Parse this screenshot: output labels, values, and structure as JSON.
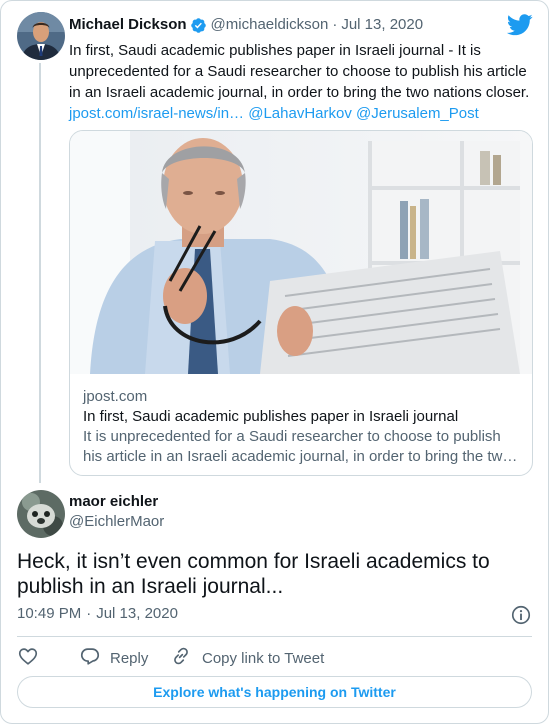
{
  "parent_tweet": {
    "author_name": "Michael Dickson",
    "handle": "@michaeldickson",
    "separator": "·",
    "date": "Jul 13, 2020",
    "text": "In first, Saudi academic publishes paper in Israeli journal  - It is unprecedented for a Saudi researcher to choose to publish his article in an Israeli academic journal, in order to bring the two nations closer.",
    "link_url": "jpost.com/israel-news/in…",
    "mention_1": "@LahavHarkov",
    "mention_2": "@Jerusalem_Post"
  },
  "link_card": {
    "domain": "jpost.com",
    "title": "In first, Saudi academic publishes paper in Israeli journal",
    "description": "It is unprecedented for a Saudi researcher to choose to publish his article in an Israeli academic journal, in order to bring the tw…"
  },
  "reply_tweet": {
    "author_name": "maor eichler",
    "handle": "@EichlerMaor",
    "text": "Heck, it isn’t even common for Israeli academics to publish in an Israeli journal...",
    "time": "10:49 PM",
    "separator": "·",
    "date": "Jul 13, 2020"
  },
  "actions": {
    "reply_label": "Reply",
    "copy_link_label": "Copy link to Tweet"
  },
  "explore_label": "Explore what's happening on Twitter",
  "icons": {
    "verified": "verified-badge-icon",
    "brand": "twitter-bird-icon",
    "info": "info-icon",
    "like": "heart-icon",
    "reply": "reply-bubble-icon",
    "copy_link": "link-icon"
  },
  "colors": {
    "accent": "#1d9bf0",
    "text_primary": "#0f1419",
    "text_secondary": "#536471",
    "border": "#cfd9de"
  }
}
